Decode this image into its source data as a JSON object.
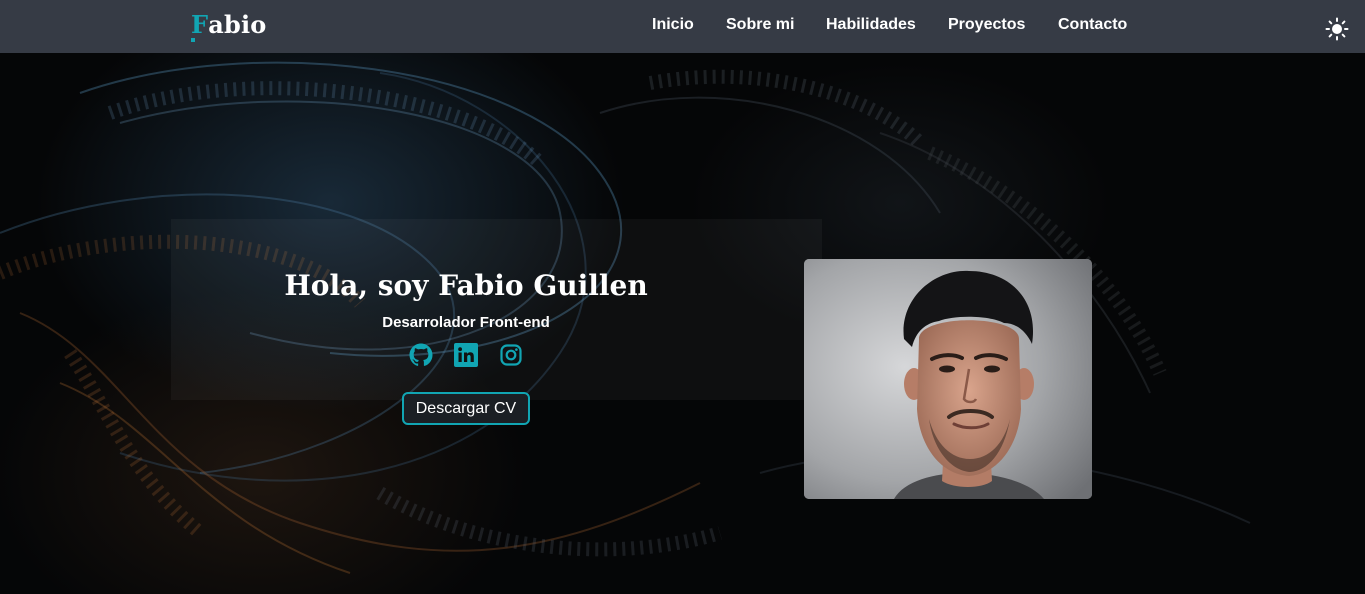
{
  "logo": {
    "first_letter": "F",
    "rest": "abio"
  },
  "nav": {
    "items": [
      {
        "label": "Inicio"
      },
      {
        "label": "Sobre mi"
      },
      {
        "label": "Habilidades"
      },
      {
        "label": "Proyectos"
      },
      {
        "label": "Contacto"
      }
    ],
    "theme_toggle_icon": "sun-icon"
  },
  "hero": {
    "title": "Hola, soy Fabio Guillen",
    "subtitle": "Desarrolador Front-end",
    "socials": [
      {
        "name": "github-icon"
      },
      {
        "name": "linkedin-icon"
      },
      {
        "name": "instagram-icon"
      }
    ],
    "cv_button": "Descargar CV",
    "photo": "profile-photo"
  },
  "colors": {
    "accent": "#11a5b3",
    "navbar": "#363b45",
    "text": "#ffffff"
  }
}
